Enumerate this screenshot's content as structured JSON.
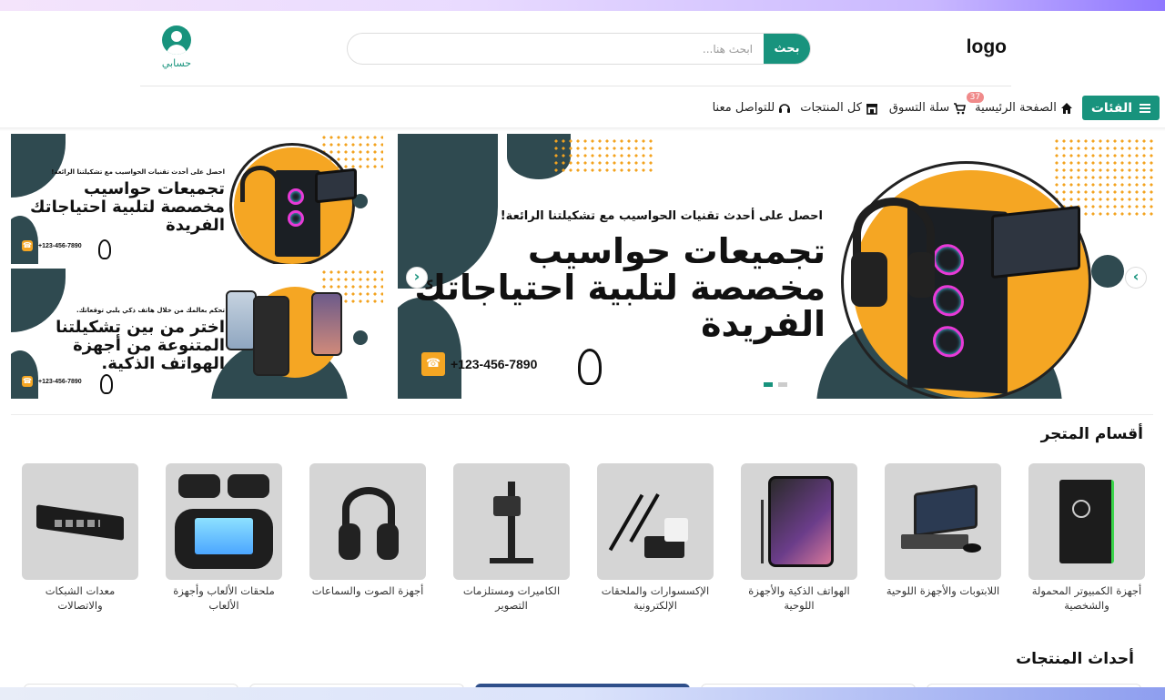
{
  "header": {
    "logo": "logo",
    "search": {
      "button_label": "بحث",
      "placeholder": "ابحث هنا..."
    },
    "account_label": "حسابي"
  },
  "nav": {
    "categories_button": "الفئات",
    "links": [
      {
        "label": "الصفحة الرئيسية",
        "icon": "home-icon"
      },
      {
        "label": "سلة التسوق",
        "icon": "cart-icon",
        "badge": "37"
      },
      {
        "label": "كل المنتجات",
        "icon": "store-icon"
      },
      {
        "label": "للتواصل معنا",
        "icon": "headset-icon"
      }
    ]
  },
  "banners": {
    "computers": {
      "subtitle": "احصل على أحدث تقنيات الحواسيب مع تشكيلتنا الرائعة!",
      "title_line1": "تجميعات حواسيب",
      "title_line2": "مخصصة لتلبية احتياجاتك",
      "title_line3": "الفريدة",
      "phone": "+123-456-7890"
    },
    "phones": {
      "subtitle": "تحكم بعالمك من خلال هاتف ذكي يلبي توقعاتك.",
      "title_line1": "اختر من بين تشكيلتنا",
      "title_line2": "المتنوعة من أجهزة",
      "title_line3": "الهواتف الذكية.",
      "phone": "+123-456-7890"
    },
    "slider": {
      "slides": 2,
      "active": 1,
      "prev_arrow": "‹",
      "next_arrow": "›"
    }
  },
  "sections": {
    "store_sections_title": "أقسام المتجر",
    "newest_title": "أحداث المنتجات"
  },
  "categories": [
    {
      "label": "أجهزة الكمبيوتر المحمولة والشخصية"
    },
    {
      "label": "اللابتوبات والأجهزة اللوحية"
    },
    {
      "label": "الهواتف الذكية والأجهزة اللوحية"
    },
    {
      "label": "الإكسسوارات والملحقات الإلكترونية"
    },
    {
      "label": "الكاميرات ومستلزمات التصوير"
    },
    {
      "label": "أجهزة الصوت والسماعات"
    },
    {
      "label": "ملحقات الألعاب وأجهزة الألعاب"
    },
    {
      "label": "معدات الشبكات والاتصالات"
    }
  ],
  "colors": {
    "accent": "#18937d",
    "orange": "#f5a623",
    "dark_teal": "#2f4a50",
    "badge": "#f08a8a"
  }
}
